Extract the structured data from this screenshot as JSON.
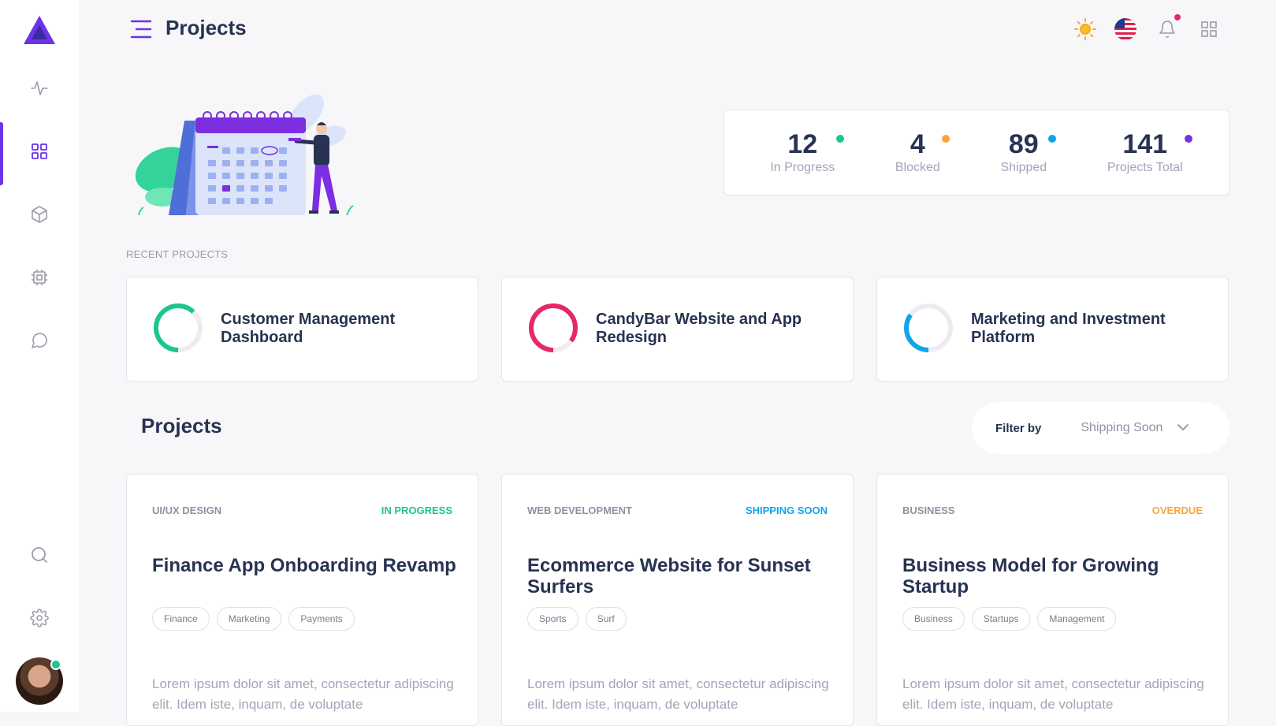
{
  "header": {
    "title": "Projects"
  },
  "stats": [
    {
      "value": "12",
      "label": "In Progress",
      "color": "#1ec58f"
    },
    {
      "value": "4",
      "label": "Blocked",
      "color": "#f4a63d"
    },
    {
      "value": "89",
      "label": "Shipped",
      "color": "#0ea5e9"
    },
    {
      "value": "141",
      "label": "Projects Total",
      "color": "#7b2fe0"
    }
  ],
  "recent": {
    "label": "RECENT PROJECTS",
    "items": [
      {
        "title": "Customer Management Dashboard",
        "progress": 0.62,
        "color": "#1ec58f"
      },
      {
        "title": "CandyBar Website and App Redesign",
        "progress": 0.85,
        "color": "#e62965"
      },
      {
        "title": "Marketing and Investment Platform",
        "progress": 0.35,
        "color": "#0ea5e9"
      }
    ]
  },
  "projects": {
    "heading": "Projects",
    "filter_label": "Filter by",
    "filter_value": "Shipping Soon",
    "cards": [
      {
        "category": "UI/UX DESIGN",
        "status": "IN PROGRESS",
        "status_color": "#1ec58f",
        "title": "Finance App Onboarding Revamp",
        "tags": [
          "Finance",
          "Marketing",
          "Payments"
        ],
        "desc": "Lorem ipsum dolor sit amet, consectetur adipiscing elit. Idem iste, inquam, de voluptate"
      },
      {
        "category": "WEB DEVELOPMENT",
        "status": "SHIPPING SOON",
        "status_color": "#0ea5e9",
        "title": "Ecommerce Website for Sunset Surfers",
        "tags": [
          "Sports",
          "Surf"
        ],
        "desc": "Lorem ipsum dolor sit amet, consectetur adipiscing elit. Idem iste, inquam, de voluptate"
      },
      {
        "category": "BUSINESS",
        "status": "OVERDUE",
        "status_color": "#f4a63d",
        "title": "Business Model for Growing Startup",
        "tags": [
          "Business",
          "Startups",
          "Management"
        ],
        "desc": "Lorem ipsum dolor sit amet, consectetur adipiscing elit. Idem iste, inquam, de voluptate"
      }
    ]
  },
  "icons": {
    "sidebar": [
      "activity-icon",
      "grid-icon",
      "cube-icon",
      "cpu-icon",
      "chat-icon",
      "search-icon",
      "settings-icon"
    ],
    "topbar": [
      "sun-icon",
      "us-flag-icon",
      "bell-icon",
      "apps-grid-icon"
    ]
  },
  "colors": {
    "accent": "#6c33e9"
  }
}
